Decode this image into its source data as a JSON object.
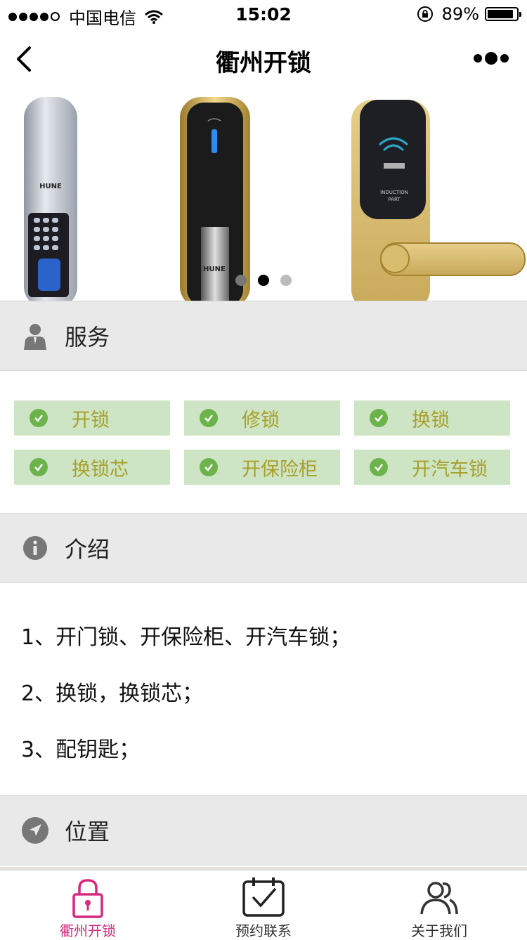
{
  "status_bar": {
    "carrier": "中国电信",
    "time": "15:02",
    "battery": "89%",
    "battery_level": 0.89
  },
  "navbar": {
    "title": "衢州开锁",
    "back_icon": "chevron-left-icon",
    "more_icon": "more-dots-icon"
  },
  "banner": {
    "slide_count": 3,
    "active_index": 1
  },
  "sections": {
    "service": {
      "title": "服务",
      "icon": "person-icon"
    },
    "intro": {
      "title": "介绍",
      "icon": "info-icon"
    },
    "location": {
      "title": "位置",
      "icon": "location-arrow-icon"
    }
  },
  "services": [
    {
      "label": "开锁"
    },
    {
      "label": "修锁"
    },
    {
      "label": "换锁"
    },
    {
      "label": "换锁芯"
    },
    {
      "label": "开保险柜"
    },
    {
      "label": "开汽车锁"
    }
  ],
  "intro_lines": [
    "1、开门锁、开保险柜、开汽车锁；",
    "2、换锁，换锁芯；",
    "3、配钥匙；"
  ],
  "tabbar": [
    {
      "label": "衢州开锁",
      "icon": "lock-icon",
      "active": true
    },
    {
      "label": "预约联系",
      "icon": "calendar-check-icon",
      "active": false
    },
    {
      "label": "关于我们",
      "icon": "users-icon",
      "active": false
    }
  ],
  "colors": {
    "tab_active": "#d6297c",
    "tag_bg": "#cde5c4",
    "tag_text": "#a8a02e",
    "check": "#6cb34c",
    "section_bg": "#e9e9e9"
  }
}
